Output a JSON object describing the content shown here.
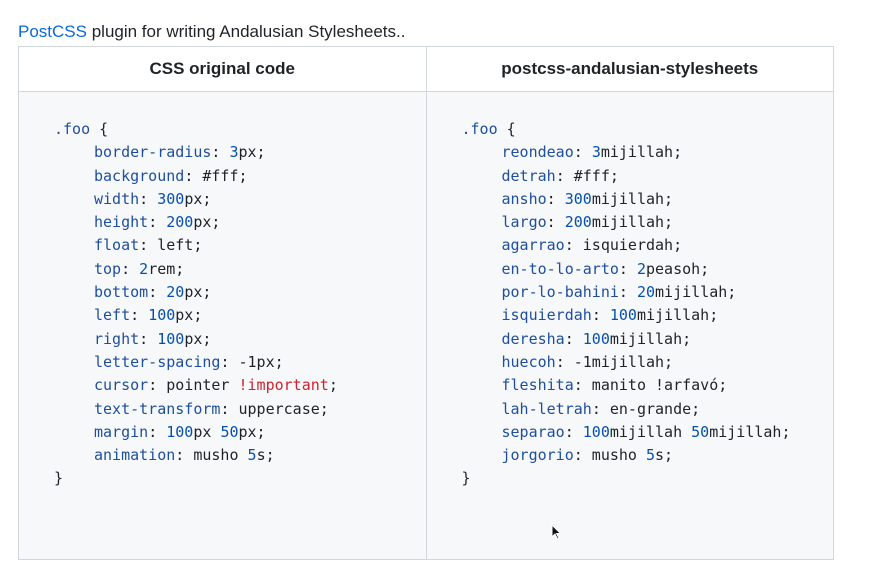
{
  "intro": {
    "link_text": "PostCSS",
    "rest_text": " plugin for writing Andalusian Stylesheets.."
  },
  "table": {
    "headers": [
      "CSS original code",
      "postcss-andalusian-stylesheets"
    ],
    "left_code": {
      "selector": ".foo",
      "open": " {",
      "close": "}",
      "lines": [
        {
          "prop": "border-radius",
          "num": "3",
          "rest": "px;"
        },
        {
          "prop": "background",
          "num": "",
          "rest": " #fff;"
        },
        {
          "prop": "width",
          "num": "300",
          "rest": "px;"
        },
        {
          "prop": "height",
          "num": "200",
          "rest": "px;"
        },
        {
          "prop": "float",
          "num": "",
          "rest": " left;"
        },
        {
          "prop": "top",
          "num": "2",
          "rest": "rem;"
        },
        {
          "prop": "bottom",
          "num": "20",
          "rest": "px;"
        },
        {
          "prop": "left",
          "num": "100",
          "rest": "px;"
        },
        {
          "prop": "right",
          "num": "100",
          "rest": "px;"
        },
        {
          "prop": "letter-spacing",
          "num": "",
          "rest": " -1px;"
        },
        {
          "prop": "cursor",
          "num": "",
          "rest": " pointer ",
          "imp": "!important",
          "tail": ";"
        },
        {
          "prop": "text-transform",
          "num": "",
          "rest": " uppercase;"
        },
        {
          "prop": "margin",
          "num": "100",
          "rest": "px ",
          "num2": "50",
          "tail": "px;"
        },
        {
          "prop": "animation",
          "num": "",
          "rest": " musho ",
          "num2": "5",
          "tail": "s;"
        }
      ]
    },
    "right_code": {
      "selector": ".foo",
      "open": " {",
      "close": "}",
      "lines": [
        {
          "prop": "reondeao",
          "num": "3",
          "rest": "mijillah;"
        },
        {
          "prop": "detrah",
          "num": "",
          "rest": " #fff;"
        },
        {
          "prop": "ansho",
          "num": "300",
          "rest": "mijillah;"
        },
        {
          "prop": "largo",
          "num": "200",
          "rest": "mijillah;"
        },
        {
          "prop": "agarrao",
          "num": "",
          "rest": " isquierdah;"
        },
        {
          "prop": "en-to-lo-arto",
          "num": "2",
          "rest": "peasoh;"
        },
        {
          "prop": "por-lo-bahini",
          "num": "20",
          "rest": "mijillah;"
        },
        {
          "prop": "isquierdah",
          "num": "100",
          "rest": "mijillah;"
        },
        {
          "prop": "deresha",
          "num": "100",
          "rest": "mijillah;"
        },
        {
          "prop": "huecoh",
          "num": "",
          "rest": " -1mijillah;"
        },
        {
          "prop": "fleshita",
          "num": "",
          "rest": " manito !arfavó;"
        },
        {
          "prop": "lah-letrah",
          "num": "",
          "rest": " en-grande;"
        },
        {
          "prop": "separao",
          "num": "100",
          "rest": "mijillah ",
          "num2": "50",
          "tail": "mijillah;"
        },
        {
          "prop": "jorgorio",
          "num": "",
          "rest": " musho ",
          "num2": "5",
          "tail": "s;"
        }
      ]
    }
  },
  "colors": {
    "link": "#0969da",
    "property": "#1f4e9e",
    "number": "#0550ae",
    "important": "#cf222e",
    "code_bg": "#f6f8fa",
    "border": "#d0d7de"
  },
  "icons": {
    "mouse_cursor": "mouse-pointer-icon"
  }
}
